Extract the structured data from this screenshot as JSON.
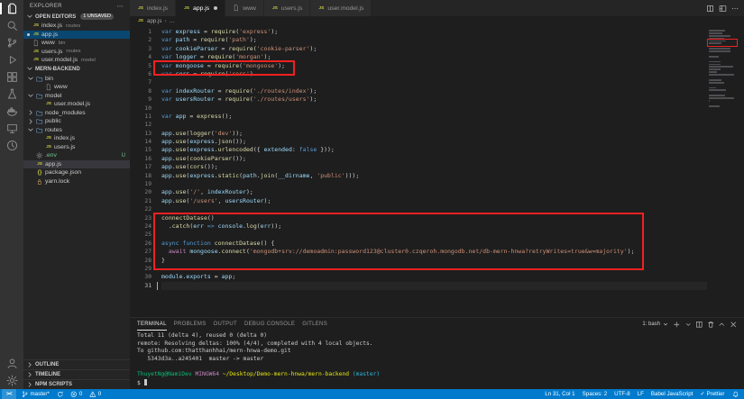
{
  "colors": {
    "accent": "#007acc",
    "annotation_red": "#f02121",
    "git_untracked": "#73c991",
    "git_modified": "#e2c08d"
  },
  "activity_bar": {
    "top": [
      {
        "name": "explorer",
        "active": true
      },
      {
        "name": "search"
      },
      {
        "name": "source-control"
      },
      {
        "name": "run-and-debug"
      },
      {
        "name": "extensions"
      },
      {
        "name": "testing"
      },
      {
        "name": "docker"
      },
      {
        "name": "remote-explorer"
      },
      {
        "name": "gitlens"
      }
    ],
    "bottom": [
      {
        "name": "account"
      },
      {
        "name": "settings"
      }
    ]
  },
  "sidebar": {
    "title": "EXPLORER",
    "more_actions": "⋯",
    "open_editors": {
      "header": "OPEN EDITORS",
      "badge": "1 UNSAVED",
      "items": [
        {
          "label": "index.js",
          "desc": "routes",
          "icon": "js",
          "dirty": false,
          "active": false
        },
        {
          "label": "app.js",
          "desc": "",
          "icon": "js",
          "dirty": true,
          "active": true
        },
        {
          "label": "www",
          "desc": "bin",
          "icon": "file",
          "dirty": false,
          "active": false
        },
        {
          "label": "users.js",
          "desc": "routes",
          "icon": "js",
          "dirty": false,
          "active": false
        },
        {
          "label": "user.model.js",
          "desc": "model",
          "icon": "js",
          "dirty": false,
          "active": false
        }
      ]
    },
    "workspace": {
      "root": "MERN-BACKEND",
      "items": [
        {
          "label": "bin",
          "kind": "folder",
          "expanded": true,
          "depth": 0
        },
        {
          "label": "www",
          "kind": "file",
          "icon": "file",
          "depth": 1
        },
        {
          "label": "model",
          "kind": "folder",
          "expanded": true,
          "depth": 0
        },
        {
          "label": "user.model.js",
          "kind": "file",
          "icon": "js",
          "depth": 1
        },
        {
          "label": "node_modules",
          "kind": "folder",
          "expanded": false,
          "depth": 0
        },
        {
          "label": "public",
          "kind": "folder",
          "expanded": false,
          "depth": 0
        },
        {
          "label": "routes",
          "kind": "folder",
          "expanded": true,
          "depth": 0
        },
        {
          "label": "index.js",
          "kind": "file",
          "icon": "js",
          "depth": 1
        },
        {
          "label": "users.js",
          "kind": "file",
          "icon": "js",
          "depth": 1
        },
        {
          "label": ".env",
          "kind": "file",
          "icon": "gear",
          "depth": 0,
          "git": "U"
        },
        {
          "label": "app.js",
          "kind": "file",
          "icon": "js",
          "depth": 0,
          "selected": true
        },
        {
          "label": "package.json",
          "kind": "file",
          "icon": "json",
          "depth": 0
        },
        {
          "label": "yarn.lock",
          "kind": "file",
          "icon": "lock",
          "depth": 0
        }
      ]
    },
    "bottom_sections": [
      {
        "label": "OUTLINE"
      },
      {
        "label": "TIMELINE"
      },
      {
        "label": "NPM SCRIPTS"
      }
    ]
  },
  "editor": {
    "tabs": [
      {
        "label": "index.js",
        "icon": "js",
        "active": false,
        "dirty": false
      },
      {
        "label": "app.js",
        "icon": "js",
        "active": true,
        "dirty": true
      },
      {
        "label": "www",
        "icon": "file",
        "active": false,
        "dirty": false
      },
      {
        "label": "users.js",
        "icon": "js",
        "active": false,
        "dirty": false
      },
      {
        "label": "user.model.js",
        "icon": "js",
        "active": false,
        "dirty": false
      }
    ],
    "actions": [
      {
        "name": "split-editor",
        "icon": "split-editor"
      },
      {
        "name": "customize-layout",
        "icon": "customize-layout"
      },
      {
        "name": "more-actions",
        "icon": "more"
      }
    ],
    "breadcrumb": {
      "file": "app.js",
      "separator": "›",
      "more": "…"
    },
    "cursor": {
      "line": 31,
      "col": 1
    },
    "annotations": [
      {
        "from": 5,
        "to": 5
      },
      {
        "from": 23,
        "to": 28
      }
    ],
    "code_lines": [
      [
        [
          "k",
          "var "
        ],
        [
          "v",
          "express"
        ],
        [
          "p",
          " = "
        ],
        [
          "f",
          "require"
        ],
        [
          "p",
          "("
        ],
        [
          "s",
          "'express'"
        ],
        [
          "p",
          ");"
        ]
      ],
      [
        [
          "k",
          "var "
        ],
        [
          "v",
          "path"
        ],
        [
          "p",
          " = "
        ],
        [
          "f",
          "require"
        ],
        [
          "p",
          "("
        ],
        [
          "s",
          "'path'"
        ],
        [
          "p",
          ");"
        ]
      ],
      [
        [
          "k",
          "var "
        ],
        [
          "v",
          "cookieParser"
        ],
        [
          "p",
          " = "
        ],
        [
          "f",
          "require"
        ],
        [
          "p",
          "("
        ],
        [
          "s",
          "'cookie-parser'"
        ],
        [
          "p",
          ");"
        ]
      ],
      [
        [
          "k",
          "var "
        ],
        [
          "v",
          "logger"
        ],
        [
          "p",
          " = "
        ],
        [
          "f",
          "require"
        ],
        [
          "p",
          "("
        ],
        [
          "s",
          "'morgan'"
        ],
        [
          "p",
          ");"
        ]
      ],
      [
        [
          "k",
          "var "
        ],
        [
          "v",
          "mongoose"
        ],
        [
          "p",
          " = "
        ],
        [
          "f",
          "require"
        ],
        [
          "p",
          "("
        ],
        [
          "s",
          "'mongoose'"
        ],
        [
          "p",
          ");"
        ]
      ],
      [
        [
          "k",
          "var "
        ],
        [
          "v",
          "cors"
        ],
        [
          "p",
          " = "
        ],
        [
          "f",
          "require"
        ],
        [
          "p",
          "("
        ],
        [
          "s",
          "'cors'"
        ],
        [
          "p",
          ")"
        ]
      ],
      [],
      [
        [
          "k",
          "var "
        ],
        [
          "v",
          "indexRouter"
        ],
        [
          "p",
          " = "
        ],
        [
          "f",
          "require"
        ],
        [
          "p",
          "("
        ],
        [
          "s",
          "'./routes/index'"
        ],
        [
          "p",
          ");"
        ]
      ],
      [
        [
          "k",
          "var "
        ],
        [
          "v",
          "usersRouter"
        ],
        [
          "p",
          " = "
        ],
        [
          "f",
          "require"
        ],
        [
          "p",
          "("
        ],
        [
          "s",
          "'./routes/users'"
        ],
        [
          "p",
          ");"
        ]
      ],
      [],
      [
        [
          "k",
          "var "
        ],
        [
          "v",
          "app"
        ],
        [
          "p",
          " = "
        ],
        [
          "f",
          "express"
        ],
        [
          "p",
          "();"
        ]
      ],
      [],
      [
        [
          "v",
          "app"
        ],
        [
          "p",
          "."
        ],
        [
          "f",
          "use"
        ],
        [
          "p",
          "("
        ],
        [
          "f",
          "logger"
        ],
        [
          "p",
          "("
        ],
        [
          "s",
          "'dev'"
        ],
        [
          "p",
          "));"
        ]
      ],
      [
        [
          "v",
          "app"
        ],
        [
          "p",
          "."
        ],
        [
          "f",
          "use"
        ],
        [
          "p",
          "("
        ],
        [
          "v",
          "express"
        ],
        [
          "p",
          "."
        ],
        [
          "f",
          "json"
        ],
        [
          "p",
          "());"
        ]
      ],
      [
        [
          "v",
          "app"
        ],
        [
          "p",
          "."
        ],
        [
          "f",
          "use"
        ],
        [
          "p",
          "("
        ],
        [
          "v",
          "express"
        ],
        [
          "p",
          "."
        ],
        [
          "f",
          "urlencoded"
        ],
        [
          "p",
          "({ "
        ],
        [
          "v",
          "extended"
        ],
        [
          "p",
          ": "
        ],
        [
          "k",
          "false"
        ],
        [
          "p",
          " }));"
        ]
      ],
      [
        [
          "v",
          "app"
        ],
        [
          "p",
          "."
        ],
        [
          "f",
          "use"
        ],
        [
          "p",
          "("
        ],
        [
          "f",
          "cookieParser"
        ],
        [
          "p",
          "());"
        ]
      ],
      [
        [
          "v",
          "app"
        ],
        [
          "p",
          "."
        ],
        [
          "f",
          "use"
        ],
        [
          "p",
          "("
        ],
        [
          "f",
          "cors"
        ],
        [
          "p",
          "());"
        ]
      ],
      [
        [
          "v",
          "app"
        ],
        [
          "p",
          "."
        ],
        [
          "f",
          "use"
        ],
        [
          "p",
          "("
        ],
        [
          "v",
          "express"
        ],
        [
          "p",
          "."
        ],
        [
          "f",
          "static"
        ],
        [
          "p",
          "("
        ],
        [
          "v",
          "path"
        ],
        [
          "p",
          "."
        ],
        [
          "f",
          "join"
        ],
        [
          "p",
          "("
        ],
        [
          "v",
          "__dirname"
        ],
        [
          "p",
          ", "
        ],
        [
          "s",
          "'public'"
        ],
        [
          "p",
          ")));"
        ]
      ],
      [],
      [
        [
          "v",
          "app"
        ],
        [
          "p",
          "."
        ],
        [
          "f",
          "use"
        ],
        [
          "p",
          "("
        ],
        [
          "s",
          "'/'"
        ],
        [
          "p",
          ", "
        ],
        [
          "v",
          "indexRouter"
        ],
        [
          "p",
          ");"
        ]
      ],
      [
        [
          "v",
          "app"
        ],
        [
          "p",
          "."
        ],
        [
          "f",
          "use"
        ],
        [
          "p",
          "("
        ],
        [
          "s",
          "'/users'"
        ],
        [
          "p",
          ", "
        ],
        [
          "v",
          "usersRouter"
        ],
        [
          "p",
          ");"
        ]
      ],
      [],
      [
        [
          "f",
          "connectDatase"
        ],
        [
          "p",
          "()"
        ]
      ],
      [
        [
          "p",
          "  ."
        ],
        [
          "f",
          "catch"
        ],
        [
          "p",
          "("
        ],
        [
          "v",
          "err"
        ],
        [
          "p",
          " "
        ],
        [
          "k",
          "=>"
        ],
        [
          "p",
          " "
        ],
        [
          "v",
          "console"
        ],
        [
          "p",
          "."
        ],
        [
          "f",
          "log"
        ],
        [
          "p",
          "("
        ],
        [
          "v",
          "err"
        ],
        [
          "p",
          "));"
        ]
      ],
      [],
      [
        [
          "k",
          "async function "
        ],
        [
          "f",
          "connectDatase"
        ],
        [
          "p",
          "() {"
        ]
      ],
      [
        [
          "p",
          "  "
        ],
        [
          "c",
          "await "
        ],
        [
          "v",
          "mongoose"
        ],
        [
          "p",
          "."
        ],
        [
          "f",
          "connect"
        ],
        [
          "p",
          "("
        ],
        [
          "s",
          "'mongodb+srv://demoadmin:password123@cluster0.czqeroh.mongodb.net/db-mern-hnwa?retryWrites=true&w=majority'"
        ],
        [
          "p",
          ");"
        ]
      ],
      [
        [
          "p",
          "}"
        ]
      ],
      [],
      [
        [
          "v",
          "module"
        ],
        [
          "p",
          "."
        ],
        [
          "v",
          "exports"
        ],
        [
          "p",
          " = "
        ],
        [
          "v",
          "app"
        ],
        [
          "p",
          ";"
        ]
      ],
      []
    ]
  },
  "panel": {
    "tabs": [
      {
        "label": "TERMINAL",
        "active": true
      },
      {
        "label": "PROBLEMS",
        "active": false
      },
      {
        "label": "OUTPUT",
        "active": false
      },
      {
        "label": "DEBUG CONSOLE",
        "active": false
      },
      {
        "label": "GITLENS",
        "active": false
      }
    ],
    "shell": "1: bash",
    "actions": [
      {
        "name": "new-terminal",
        "icon": "plus"
      },
      {
        "name": "terminal-picker",
        "icon": "caret-down"
      },
      {
        "name": "split-terminal",
        "icon": "split-editor"
      },
      {
        "name": "kill-terminal",
        "icon": "trash"
      },
      {
        "name": "maximize-panel",
        "icon": "chevron-up"
      },
      {
        "name": "close-panel",
        "icon": "close"
      }
    ],
    "terminal_lines": [
      [
        [
          "t",
          "Total 11 (delta 4), reused 0 (delta 0)"
        ]
      ],
      [
        [
          "t",
          "remote: Resolving deltas: 100% (4/4), completed with 4 local objects."
        ]
      ],
      [
        [
          "t",
          "To github.com:thatthanhhai/mern-hnwa-demo.git"
        ]
      ],
      [
        [
          "t",
          "   5343d3a..a245401  master -> master"
        ]
      ],
      [
        [
          "t",
          ""
        ]
      ],
      [
        [
          "tg",
          "ThuyetNg@NamiDev "
        ],
        [
          "tm",
          "MINGW64 "
        ],
        [
          "ty",
          "~/Desktop/Demo-mern-hnwa/mern-backend "
        ],
        [
          "tc",
          "(master)"
        ]
      ],
      [
        [
          "t",
          "$ "
        ]
      ]
    ]
  },
  "status_bar": {
    "left": [
      {
        "name": "remote-indicator",
        "icon": "remote",
        "text": ""
      },
      {
        "name": "git-branch",
        "icon": "branch",
        "text": "master*"
      },
      {
        "name": "sync",
        "icon": "sync",
        "text": ""
      },
      {
        "name": "errors",
        "icon": "error",
        "text": "0"
      },
      {
        "name": "warnings",
        "icon": "warning",
        "text": "0"
      }
    ],
    "right": [
      {
        "name": "cursor-position",
        "text": "Ln 31, Col 1"
      },
      {
        "name": "indentation",
        "text": "Spaces: 2"
      },
      {
        "name": "encoding",
        "text": "UTF-8"
      },
      {
        "name": "eol",
        "text": "LF"
      },
      {
        "name": "language-mode",
        "text": "Babel JavaScript"
      },
      {
        "name": "formatter",
        "icon": "check",
        "text": "Prettier"
      },
      {
        "name": "notifications",
        "icon": "bell",
        "text": ""
      }
    ]
  }
}
